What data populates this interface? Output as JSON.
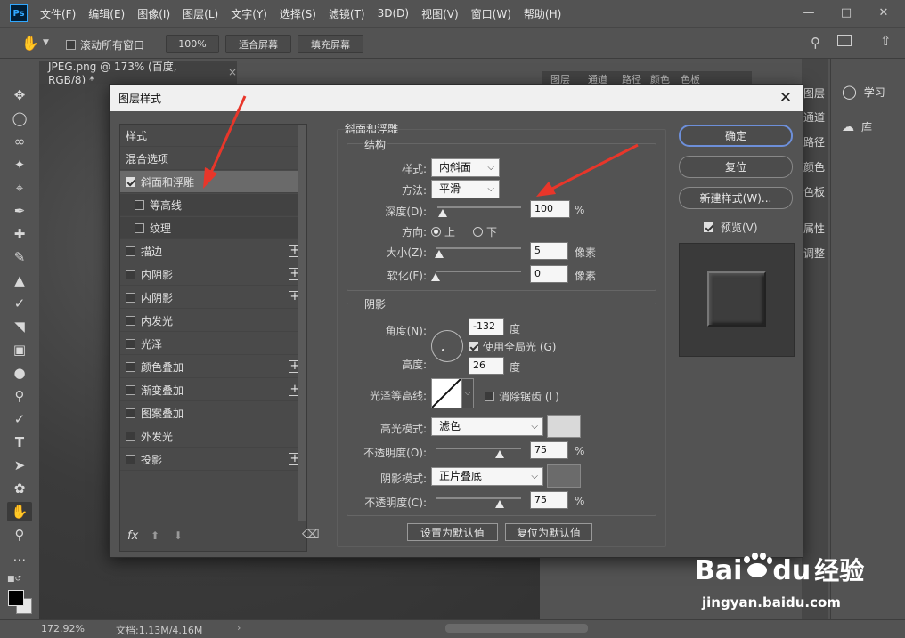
{
  "menubar": {
    "logo": "Ps",
    "items": [
      "文件(F)",
      "编辑(E)",
      "图像(I)",
      "图层(L)",
      "文字(Y)",
      "选择(S)",
      "滤镜(T)",
      "3D(D)",
      "视图(V)",
      "窗口(W)",
      "帮助(H)"
    ]
  },
  "optbar": {
    "scroll_all_label": "滚动所有窗口",
    "zoom_btn": "100%",
    "fit_screen": "适合屏幕",
    "fill_screen": "填充屏幕"
  },
  "doc_tab": {
    "title": "JPEG.png @ 173% (百度, RGB/8) *",
    "close": "×"
  },
  "right_panel": {
    "tabs": [
      "图层",
      "通道",
      "路径",
      "颜色",
      "色板"
    ],
    "side_labels": [
      "图层",
      "通道",
      "路径",
      "颜色",
      "色板",
      "属性",
      "调整"
    ],
    "learn": "学习",
    "library": "库"
  },
  "status": {
    "zoom": "172.92%",
    "doc": "文档:1.13M/4.16M"
  },
  "dialog": {
    "title": "图层样式",
    "style_list": {
      "header": "样式",
      "blend": "混合选项",
      "items": [
        {
          "label": "斜面和浮雕",
          "checked": true,
          "plus": false,
          "indent": false,
          "selected": true
        },
        {
          "label": "等高线",
          "checked": false,
          "plus": false,
          "indent": true
        },
        {
          "label": "纹理",
          "checked": false,
          "plus": false,
          "indent": true
        },
        {
          "label": "描边",
          "checked": false,
          "plus": true
        },
        {
          "label": "内阴影",
          "checked": false,
          "plus": true
        },
        {
          "label": "内阴影",
          "checked": false,
          "plus": true
        },
        {
          "label": "内发光",
          "checked": false,
          "plus": false
        },
        {
          "label": "光泽",
          "checked": false,
          "plus": false
        },
        {
          "label": "颜色叠加",
          "checked": false,
          "plus": true
        },
        {
          "label": "渐变叠加",
          "checked": false,
          "plus": true
        },
        {
          "label": "图案叠加",
          "checked": false,
          "plus": false
        },
        {
          "label": "外发光",
          "checked": false,
          "plus": false
        },
        {
          "label": "投影",
          "checked": false,
          "plus": true
        }
      ],
      "fx": "fx"
    },
    "bevel": {
      "title": "斜面和浮雕",
      "structure": "结构",
      "style_label": "样式:",
      "style_value": "内斜面",
      "method_label": "方法:",
      "method_value": "平滑",
      "depth_label": "深度(D):",
      "depth_value": "100",
      "depth_unit": "%",
      "direction_label": "方向:",
      "dir_up": "上",
      "dir_down": "下",
      "size_label": "大小(Z):",
      "size_value": "5",
      "size_unit": "像素",
      "soften_label": "软化(F):",
      "soften_value": "0",
      "soften_unit": "像素"
    },
    "shading": {
      "title": "阴影",
      "angle_label": "角度(N):",
      "angle_value": "-132",
      "angle_unit": "度",
      "global_light": "使用全局光 (G)",
      "altitude_label": "高度:",
      "altitude_value": "26",
      "altitude_unit": "度",
      "gloss_label": "光泽等高线:",
      "anti_alias": "消除锯齿 (L)",
      "highlight_label": "高光模式:",
      "highlight_value": "滤色",
      "highlight_color": "#d9d9d9",
      "hl_opacity_label": "不透明度(O):",
      "hl_opacity_value": "75",
      "shadow_label": "阴影模式:",
      "shadow_value": "正片叠底",
      "shadow_color": "#6b6b6b",
      "sh_opacity_label": "不透明度(C):",
      "sh_opacity_value": "75",
      "pct": "%"
    },
    "buttons": {
      "ok": "确定",
      "reset": "复位",
      "new_style": "新建样式(W)...",
      "preview": "预览(V)",
      "make_default": "设置为默认值",
      "reset_default": "复位为默认值"
    }
  },
  "watermark": {
    "brand": "Bai",
    "brand2": "du",
    "cn": "经验",
    "url": "jingyan.baidu.com"
  }
}
